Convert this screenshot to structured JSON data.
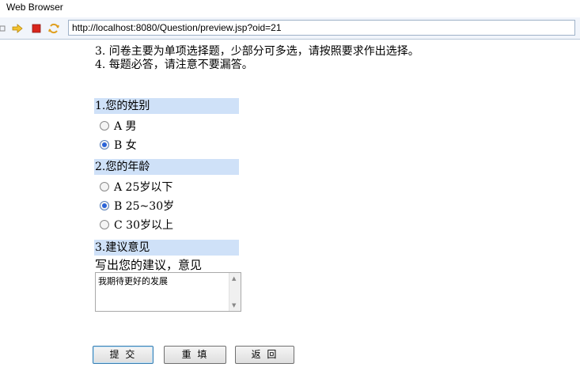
{
  "window": {
    "title": "Web Browser"
  },
  "toolbar": {
    "url": "http://localhost:8080/Question/preview.jsp?oid=21",
    "icons": [
      "back-icon",
      "forward-icon",
      "stop-icon",
      "refresh-icon"
    ]
  },
  "notes": {
    "line3": "3. 问卷主要为单项选择题，少部分可多选，请按照要求作出选择。",
    "line4": "4. 每题必答，请注意不要漏答。"
  },
  "questions": [
    {
      "title": "1.您的姓别",
      "options": [
        {
          "label": "A 男",
          "checked": false
        },
        {
          "label": "B 女",
          "checked": true
        }
      ]
    },
    {
      "title": "2.您的年龄",
      "options": [
        {
          "label": "A 25岁以下",
          "checked": false
        },
        {
          "label": "B 25~30岁",
          "checked": true
        },
        {
          "label": "C 30岁以上",
          "checked": false
        }
      ]
    },
    {
      "title": "3.建议意见",
      "prompt": "写出您的建议，意见",
      "answer": "我期待更好的发展"
    }
  ],
  "buttons": {
    "submit": "提 交",
    "reset": "重 填",
    "back": "返 回"
  }
}
